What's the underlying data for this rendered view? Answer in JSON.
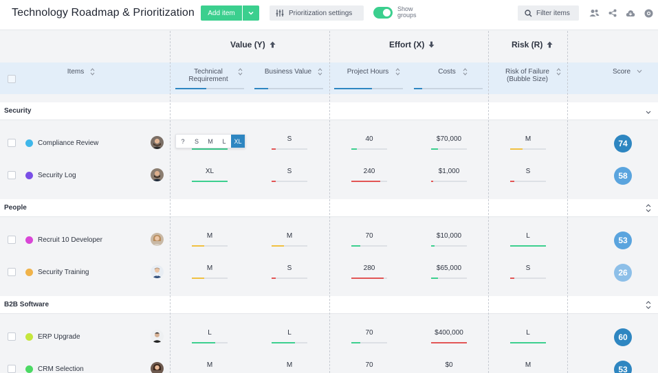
{
  "app": {
    "title": "Technology Roadmap & Prioritization",
    "add_item_label": "Add item",
    "prioritization_label": "Prioritization settings",
    "show_groups_line1": "Show",
    "show_groups_line2": "groups",
    "filter_label": "Filter items"
  },
  "header_groups": [
    {
      "label": "Value (Y)",
      "direction": "up"
    },
    {
      "label": "Effort (X)",
      "direction": "down"
    },
    {
      "label": "Risk (R)",
      "direction": "up"
    }
  ],
  "columns": {
    "items": "Items",
    "tech_line1": "Technical",
    "tech_line2": "Requirement",
    "business": "Business Value",
    "hours": "Project Hours",
    "costs": "Costs",
    "risk_line1": "Risk of Failure",
    "risk_line2": "(Bubble Size)",
    "score": "Score"
  },
  "size_options": [
    "?",
    "S",
    "M",
    "L",
    "XL"
  ],
  "size_selected": "XL",
  "groups": [
    {
      "name": "Security",
      "rows": [
        {
          "name": "Compliance Review",
          "dot": "#3fb7ea",
          "tech": "",
          "business": "S",
          "hours": "40",
          "costs": "$70,000",
          "risk": "M",
          "score": "74",
          "score_color": "#2e86c1",
          "tech_fill": 1.0,
          "business_fill": 0.12,
          "hours_fill": 0.15,
          "costs_fill": 0.2,
          "risk_fill": 0.35
        },
        {
          "name": "Security Log",
          "dot": "#7a4fe6",
          "tech": "XL",
          "business": "S",
          "hours": "240",
          "costs": "$1,000",
          "risk": "S",
          "score": "58",
          "score_color": "#5aa4de",
          "tech_fill": 1.0,
          "business_fill": 0.12,
          "hours_fill": 0.8,
          "costs_fill": 0.05,
          "risk_fill": 0.12
        }
      ]
    },
    {
      "name": "People",
      "rows": [
        {
          "name": "Recruit 10 Developer",
          "dot": "#d946d6",
          "tech": "M",
          "business": "M",
          "hours": "70",
          "costs": "$10,000",
          "risk": "L",
          "score": "53",
          "score_color": "#5aa4de",
          "tech_fill": 0.35,
          "business_fill": 0.35,
          "hours_fill": 0.25,
          "costs_fill": 0.1,
          "risk_fill": 1.0
        },
        {
          "name": "Security Training",
          "dot": "#f0b34a",
          "tech": "M",
          "business": "S",
          "hours": "280",
          "costs": "$65,000",
          "risk": "S",
          "score": "26",
          "score_color": "#8dbfe8",
          "tech_fill": 0.35,
          "business_fill": 0.12,
          "hours_fill": 0.9,
          "costs_fill": 0.2,
          "risk_fill": 0.12
        }
      ]
    },
    {
      "name": "B2B Software",
      "rows": [
        {
          "name": "ERP Upgrade",
          "dot": "#c5e63d",
          "tech": "L",
          "business": "L",
          "hours": "70",
          "costs": "$400,000",
          "risk": "L",
          "score": "60",
          "score_color": "#2e86c1",
          "tech_fill": 0.65,
          "business_fill": 0.65,
          "hours_fill": 0.25,
          "costs_fill": 1.0,
          "risk_fill": 1.0
        },
        {
          "name": "CRM Selection",
          "dot": "#4cd964",
          "tech": "M",
          "business": "M",
          "hours": "70",
          "costs": "$0",
          "risk": "M",
          "score": "53",
          "score_color": "#2e86c1",
          "tech_fill": 0.35,
          "business_fill": 0.35,
          "hours_fill": 0.25,
          "costs_fill": 0.0,
          "risk_fill": 0.35
        }
      ]
    }
  ],
  "header_fills": {
    "tech": 0.45,
    "business": 0.2,
    "hours": 0.55,
    "costs": 0.12
  },
  "colors": {
    "accent": "#3bcf8e",
    "blue": "#2e86c1",
    "green": "#3bcf8e",
    "yellow": "#f0c040",
    "red": "#e25555"
  }
}
